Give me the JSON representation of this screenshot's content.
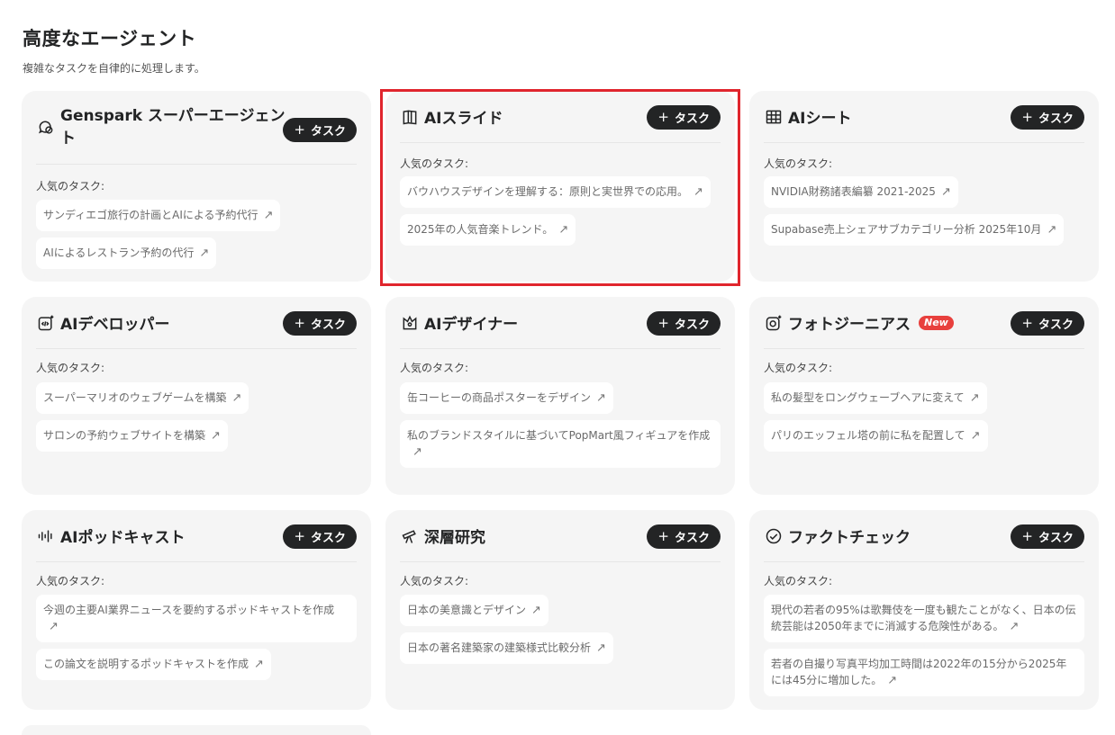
{
  "page": {
    "title": "高度なエージェント",
    "subtitle": "複雑なタスクを自律的に処理します。"
  },
  "common": {
    "task_button_label": "タスク",
    "plus_icon": "+",
    "popular_label": "人気のタスク:",
    "arrow_icon": "↗",
    "new_badge": "New"
  },
  "colors": {
    "card_bg": "#f5f5f5",
    "button_bg": "#232425",
    "highlight": "#e0252d",
    "new_badge": "#e8403d"
  },
  "cards": [
    {
      "title": "Genspark スーパーエージェント",
      "icon": "chat-bubbles-icon",
      "tasks": [
        "サンディエゴ旅行の計画とAIによる予約代行",
        "AIによるレストラン予約の代行"
      ]
    },
    {
      "title": "AIスライド",
      "icon": "book-open-icon",
      "tasks": [
        "バウハウスデザインを理解する：原則と実世界での応用。",
        "2025年の人気音楽トレンド。"
      ]
    },
    {
      "title": "AIシート",
      "icon": "table-grid-icon",
      "tasks": [
        "NVIDIA財務諸表編纂 2021-2025",
        "Supabase売上シェアサブカテゴリー分析 2025年10月"
      ]
    },
    {
      "title": "AIデベロッパー",
      "icon": "code-sparkle-icon",
      "tasks": [
        "スーパーマリオのウェブゲームを構築",
        "サロンの予約ウェブサイトを構築"
      ]
    },
    {
      "title": "AIデザイナー",
      "icon": "design-shapes-icon",
      "tasks": [
        "缶コーヒーの商品ポスターをデザイン",
        "私のブランドスタイルに基づいてPopMart風フィギュアを作成"
      ]
    },
    {
      "title": "フォトジーニアス",
      "icon": "camera-sparkle-icon",
      "badge": true,
      "tasks": [
        "私の髪型をロングウェーブヘアに変えて",
        "パリのエッフェル塔の前に私を配置して"
      ]
    },
    {
      "title": "AIポッドキャスト",
      "icon": "sound-wave-icon",
      "tasks": [
        "今週の主要AI業界ニュースを要約するポッドキャストを作成",
        "この論文を説明するポッドキャストを作成"
      ]
    },
    {
      "title": "深層研究",
      "icon": "telescope-icon",
      "tasks": [
        "日本の美意識とデザイン",
        "日本の著名建築家の建築様式比較分析"
      ]
    },
    {
      "title": "ファクトチェック",
      "icon": "check-circle-icon",
      "tasks": [
        "現代の若者の95%は歌舞伎を一度も観たことがなく、日本の伝統芸能は2050年までに消滅する危険性がある。",
        "若者の自撮り写真平均加工時間は2022年の15分から2025年には45分に増加した。"
      ]
    }
  ]
}
